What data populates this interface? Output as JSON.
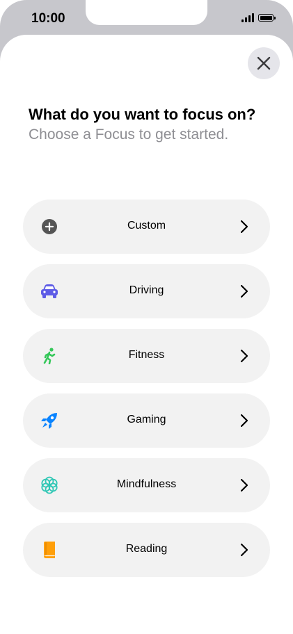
{
  "status_bar": {
    "time": "10:00"
  },
  "header": {
    "title": "What do you want to focus on?",
    "subtitle": "Choose a Focus to get started."
  },
  "focus_options": [
    {
      "label": "Custom",
      "icon": "plus-circle-icon",
      "color": "#555555"
    },
    {
      "label": "Driving",
      "icon": "car-icon",
      "color": "#5e5ce6"
    },
    {
      "label": "Fitness",
      "icon": "runner-icon",
      "color": "#34c759"
    },
    {
      "label": "Gaming",
      "icon": "rocket-icon",
      "color": "#0a84ff"
    },
    {
      "label": "Mindfulness",
      "icon": "flower-icon",
      "color": "#30c7b5"
    },
    {
      "label": "Reading",
      "icon": "book-icon",
      "color": "#ff9f0a"
    }
  ]
}
